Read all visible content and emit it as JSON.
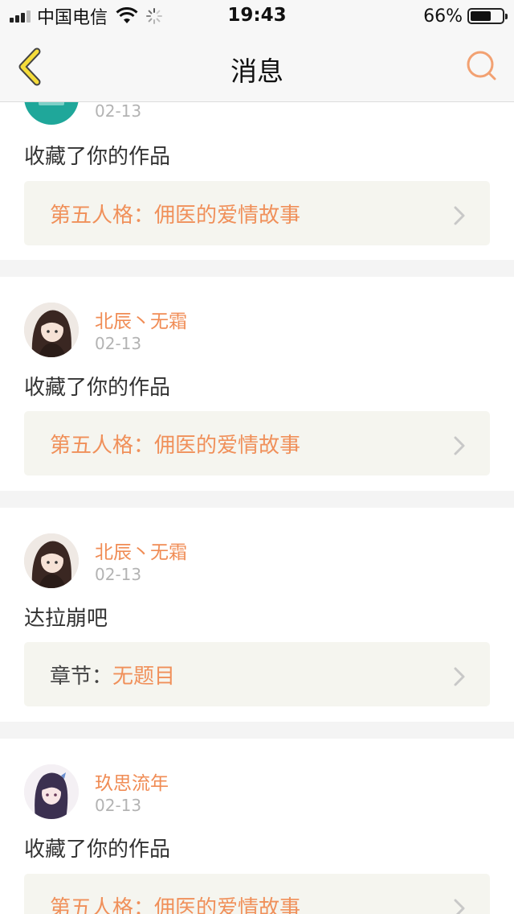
{
  "status_bar": {
    "carrier": "中国电信",
    "time": "19:43",
    "battery_percent": "66%",
    "battery_level": 0.66,
    "signal_bars": 3
  },
  "nav": {
    "title": "消息",
    "back_icon": "back-chevron-icon",
    "search_icon": "search-icon"
  },
  "colors": {
    "accent": "#f08c55",
    "back_icon": "#f5dc3a"
  },
  "messages": [
    {
      "user": "",
      "date": "02-13",
      "text": "收藏了你的作品",
      "ref_prefix": "",
      "ref_title": "第五人格：佣医的爱情故事"
    },
    {
      "user": "北辰丶无霜",
      "date": "02-13",
      "text": "收藏了你的作品",
      "ref_prefix": "",
      "ref_title": "第五人格：佣医的爱情故事"
    },
    {
      "user": "北辰丶无霜",
      "date": "02-13",
      "text": "达拉崩吧",
      "ref_prefix": "章节：",
      "ref_title": "无题目"
    },
    {
      "user": "玖思流年",
      "date": "02-13",
      "text": "收藏了你的作品",
      "ref_prefix": "",
      "ref_title": "第五人格：佣医的爱情故事"
    }
  ]
}
